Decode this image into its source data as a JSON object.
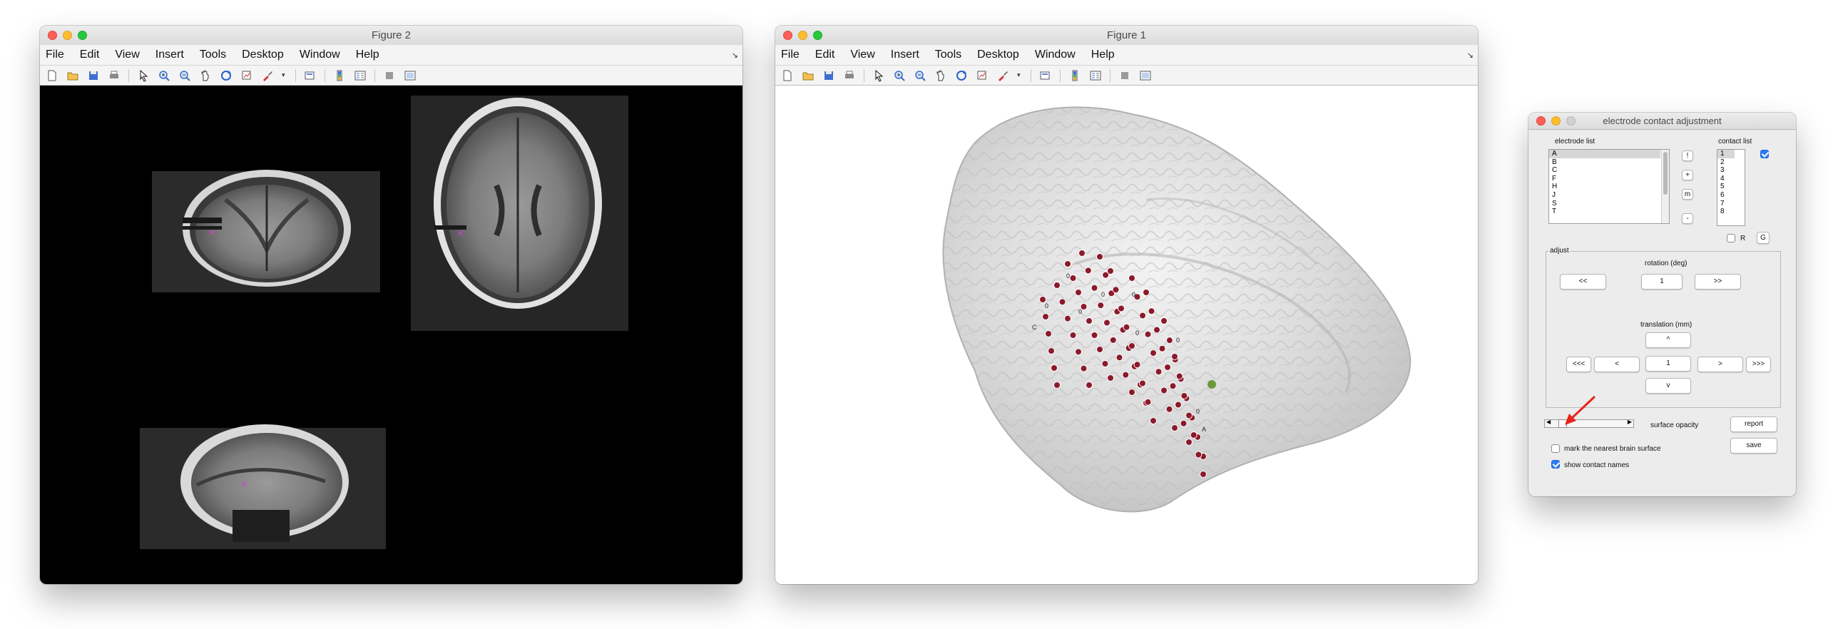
{
  "figure2": {
    "title": "Figure 2",
    "menus": [
      "File",
      "Edit",
      "View",
      "Insert",
      "Tools",
      "Desktop",
      "Window",
      "Help"
    ]
  },
  "figure1": {
    "title": "Figure 1",
    "menus": [
      "File",
      "Edit",
      "View",
      "Insert",
      "Tools",
      "Desktop",
      "Window",
      "Help"
    ],
    "labels": [
      "0",
      "0",
      "0",
      "0",
      "0",
      "0",
      "0",
      "A",
      "0",
      "C"
    ]
  },
  "toolbar_icons": [
    "new-file-icon",
    "open-file-icon",
    "save-icon",
    "print-icon",
    "pointer-icon",
    "zoom-in-icon",
    "zoom-out-icon",
    "pan-icon",
    "rotate-3d-icon",
    "data-cursor-icon",
    "brush-icon",
    "link-plot-icon",
    "colorbar-icon",
    "legend-icon",
    "hide-plot-tools-icon",
    "show-plot-tools-icon"
  ],
  "colors": {
    "marker_magenta": "#d43fd4",
    "electrode_red": "#8b1a2b",
    "electrode_green": "#6a9a3a",
    "checkbox_blue": "#2d7cf6",
    "annotation_arrow": "#e8231c"
  },
  "dialog": {
    "title": "electrode contact adjustment",
    "electrode_list_label": "electrode list",
    "electrodes": [
      "A",
      "B",
      "C",
      "F",
      "H",
      "J",
      "S",
      "T"
    ],
    "contact_list_label": "contact list",
    "contacts": [
      "1",
      "2",
      "3",
      "4",
      "5",
      "6",
      "7",
      "8"
    ],
    "side_buttons": [
      "!",
      "+",
      "m",
      "-"
    ],
    "r_label": "R",
    "g_label": "G",
    "adjust_label": "adjust",
    "rotation_label": "rotation (deg)",
    "rot_left": "<<",
    "rot_value": "1",
    "rot_right": ">>",
    "translation_label": "translation (mm)",
    "up": "^",
    "far_left": "<<<",
    "left": "<",
    "trans_value": "1",
    "right": ">",
    "far_right": ">>>",
    "down": "v",
    "surface_opacity_label": "surface opacity",
    "surface_opacity_value": 0.1,
    "report": "report",
    "save": "save",
    "mark_nearest": "mark the nearest brain surface",
    "mark_nearest_checked": false,
    "show_names": "show contact names",
    "show_names_checked": true,
    "contact_checkbox_checked": true
  }
}
